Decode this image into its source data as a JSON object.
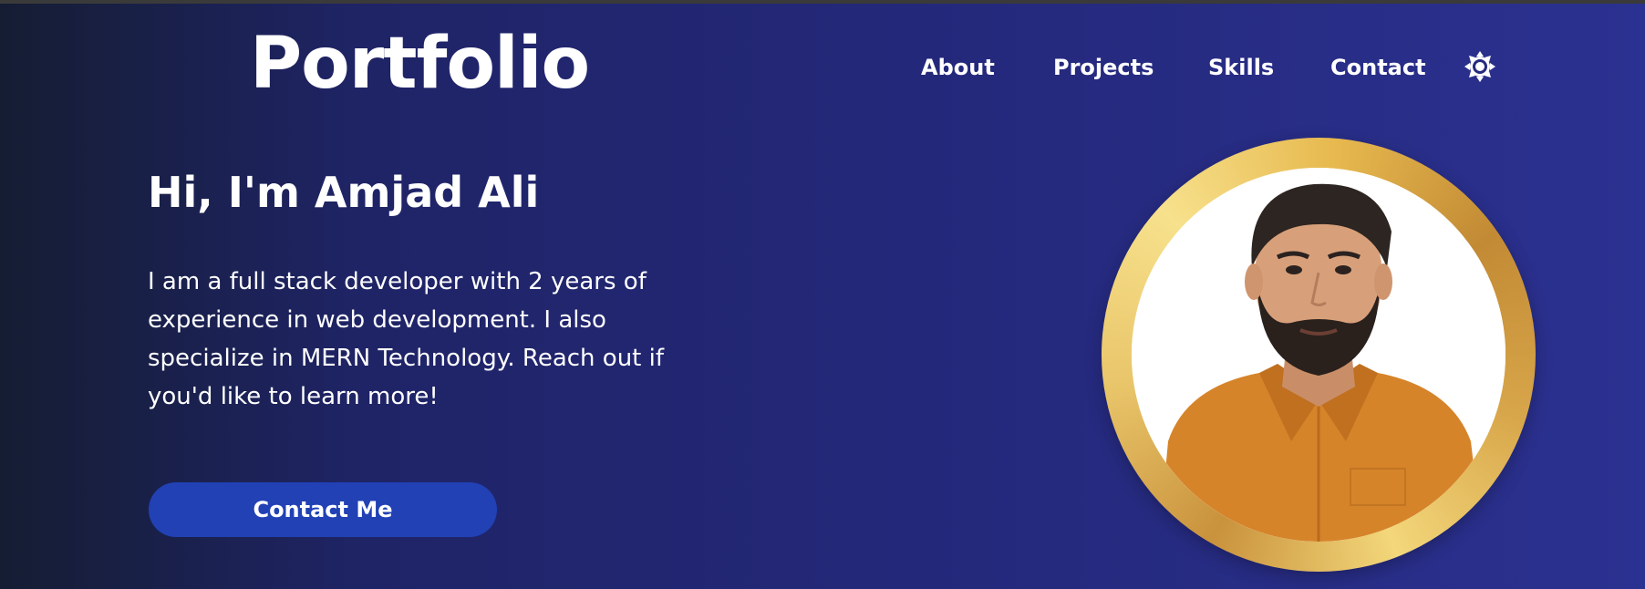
{
  "header": {
    "logo": "Portfolio",
    "nav": [
      {
        "label": "About"
      },
      {
        "label": "Projects"
      },
      {
        "label": "Skills"
      },
      {
        "label": "Contact"
      }
    ],
    "theme_toggle_icon": "sun-icon"
  },
  "hero": {
    "greeting": "Hi, I'm Amjad Ali",
    "intro_lines": [
      "I am a full stack developer with 2 years of",
      "experience in web development. I also",
      "specialize in MERN Technology. Reach out if",
      "you'd like to learn more!"
    ],
    "cta_label": "Contact Me",
    "profile_image": "profile-photo"
  },
  "colors": {
    "background_start": "#151d33",
    "background_end": "#2b3190",
    "button": "#2141b5",
    "ring_gold": "#e7b94f",
    "text": "#ffffff"
  }
}
